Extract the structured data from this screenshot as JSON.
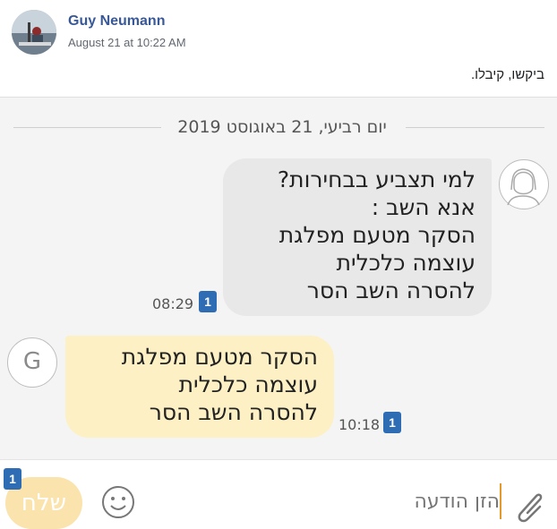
{
  "post": {
    "author": "Guy Neumann",
    "timestamp": "August 21 at 10:22 AM",
    "text": "ביקשו, קיבלו."
  },
  "chat": {
    "date_separator": "יום רביעי, 21 באוגוסט 2019",
    "messages": [
      {
        "lines": [
          "למי תצביע בבחירות?",
          "אנא השב :",
          "הסקר מטעם מפלגת",
          "עוצמה כלכלית",
          "להסרה השב הסר"
        ],
        "time": "08:29",
        "sim": "1"
      },
      {
        "lines": [
          "הסקר מטעם מפלגת",
          "עוצמה כלכלית",
          "להסרה השב הסר"
        ],
        "time": "10:18",
        "sim": "1",
        "avatar_letter": "G"
      }
    ],
    "input": {
      "placeholder": "הזן הודעה",
      "send_label": "שלח",
      "send_sim": "1"
    }
  },
  "colors": {
    "author_blue": "#385898",
    "incoming_bubble": "#e8e8e8",
    "outgoing_bubble": "#fdf0c4",
    "sim_badge": "#2e6db4",
    "send_button": "#fbe3ad"
  }
}
